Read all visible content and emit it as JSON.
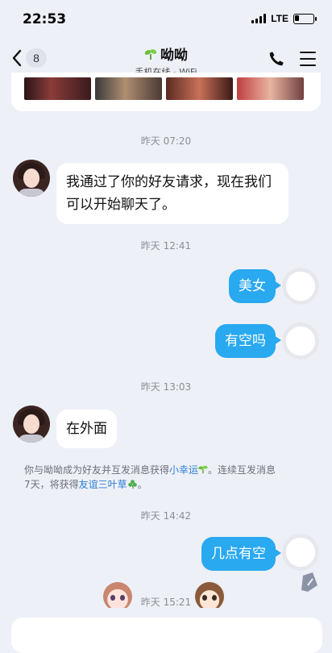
{
  "status_bar": {
    "time": "22:53",
    "network": "LTE"
  },
  "header": {
    "back_count": "8",
    "contact_name": "呦呦",
    "contact_status": "手机在线 - WiFi"
  },
  "messages": {
    "t1": "昨天 07:20",
    "m1": "我通过了你的好友请求，现在我们可以开始聊天了。",
    "t2": "昨天 12:41",
    "m2": "美女",
    "m3": "有空吗",
    "t3": "昨天 13:03",
    "m4": "在外面",
    "notice": {
      "part1": "你与呦呦成为好友并互发消息获得",
      "link1": "小幸运",
      "part2": "。连续互发消息",
      "part3": "7天，将获得",
      "link2": "友谊三叶草",
      "part4": "。"
    },
    "t4": "昨天 14:42",
    "m5": "几点有空",
    "t5": "昨天 15:21"
  },
  "colors": {
    "outgoing_bubble": "#29a9f0",
    "background": "#eef0f7",
    "link": "#2b7fd6"
  },
  "icons": [
    "back-icon",
    "sprout-icon",
    "phone-icon",
    "menu-icon",
    "clover-icon",
    "edit-icon"
  ]
}
